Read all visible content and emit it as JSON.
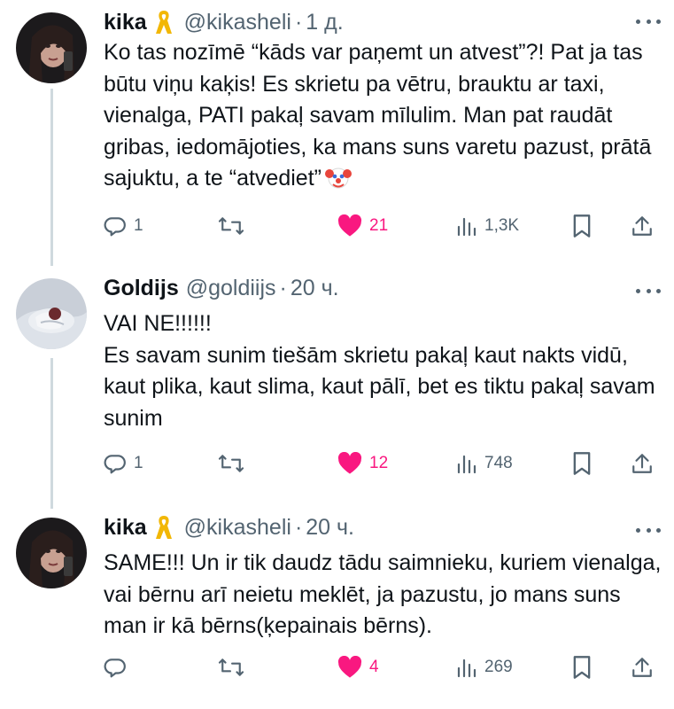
{
  "tweets": [
    {
      "name": "kika",
      "handle": "@kikasheli",
      "dot": "·",
      "time": "1 д.",
      "text": "Ko tas nozīmē “kāds var paņemt un atvest”?! Pat ja tas būtu viņu kaķis! Es skrietu pa vētru, brauktu ar taxi, vienalga, PATI pakaļ savam mīlulim. Man pat raudāt gribas, iedomājoties, ka mans suns varetu pazust, prātā sajuktu, a te “atvediet”",
      "replies": "1",
      "retweets": "",
      "likes": "21",
      "views": "1,3K",
      "emoji": "clown-face-icon"
    },
    {
      "name": "Goldijs",
      "handle": "@goldiijs",
      "dot": "·",
      "time": "20 ч.",
      "text": "VAI NE!!!!!!\nEs savam sunim tiešām skrietu pakaļ kaut nakts vidū, kaut plika, kaut slima, kaut pālī, bet es tiktu pakaļ savam sunim",
      "replies": "1",
      "retweets": "",
      "likes": "12",
      "views": "748"
    },
    {
      "name": "kika",
      "handle": "@kikasheli",
      "dot": "·",
      "time": "20 ч.",
      "text": "SAME!!! Un ir tik daudz tādu saimnieku, kuriem vienalga, vai bērnu arī neietu meklēt, ja pazustu, jo mans suns man ir kā bērns(ķepainais bērns).",
      "replies": "",
      "retweets": "",
      "likes": "4",
      "views": "269"
    }
  ],
  "colors": {
    "like_pink": "#f91880",
    "secondary_text": "#536471",
    "thread_line": "#cfd9de",
    "ribbon_gold": "#f2b705"
  },
  "icons": [
    "reply-icon",
    "retweet-icon",
    "like-heart-icon",
    "views-icon",
    "bookmark-icon",
    "share-icon",
    "more-options-icon",
    "yellow-ribbon-icon"
  ]
}
